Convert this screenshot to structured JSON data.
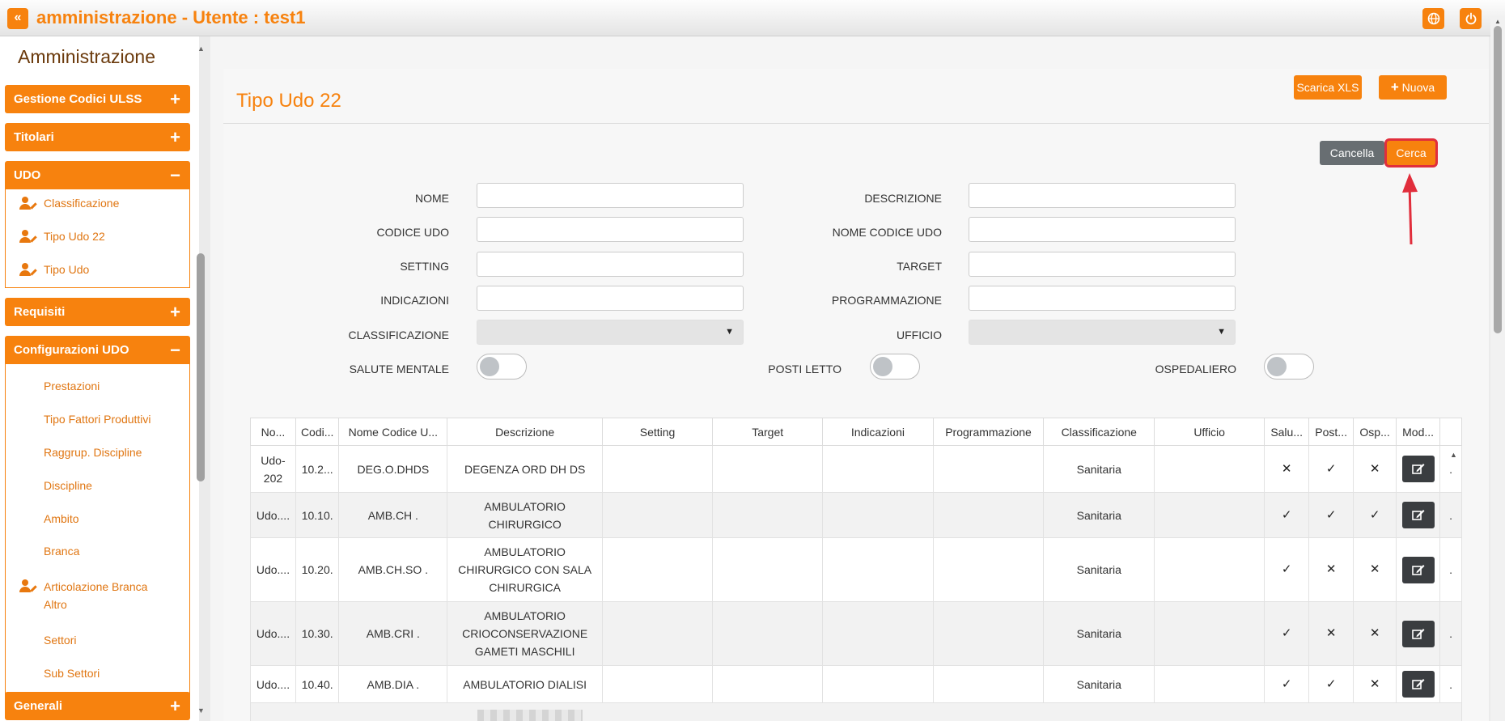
{
  "header": {
    "collapse_glyph": "«",
    "title": "amministrazione - Utente : test1",
    "icons": [
      "globe-icon",
      "power-icon"
    ]
  },
  "sidebar": {
    "title": "Amministrazione",
    "groups": [
      {
        "label": "Gestione Codici ULSS",
        "toggle": "+",
        "items": []
      },
      {
        "label": "Titolari",
        "toggle": "+",
        "items": []
      },
      {
        "label": "UDO",
        "toggle": "−",
        "items": [
          "Classificazione",
          "Tipo Udo 22",
          "Tipo Udo"
        ]
      },
      {
        "label": "Requisiti",
        "toggle": "+",
        "items": []
      },
      {
        "label": "Configurazioni UDO",
        "toggle": "−",
        "items": [
          "Prestazioni",
          "Tipo Fattori Produttivi",
          "Raggrup. Discipline",
          "Discipline",
          "Ambito",
          "Branca",
          "Articolazione Branca Altro",
          "Settori",
          "Sub Settori"
        ]
      },
      {
        "label": "Generali",
        "toggle": "+",
        "items": []
      }
    ]
  },
  "main": {
    "page_title": "Tipo Udo 22",
    "buttons": {
      "xls": "Scarica XLS",
      "new": "Nuova",
      "new_glyph": "+",
      "cancel": "Cancella",
      "search": "Cerca"
    },
    "filters": {
      "nome": "NOME",
      "descrizione": "DESCRIZIONE",
      "codice_udo": "CODICE UDO",
      "nome_codice_udo": "NOME CODICE UDO",
      "setting": "SETTING",
      "target": "TARGET",
      "indicazioni": "INDICAZIONI",
      "programmazione": "PROGRAMMAZIONE",
      "classificazione": "CLASSIFICAZIONE",
      "ufficio": "UFFICIO",
      "salute_mentale": "SALUTE MENTALE",
      "posti_letto": "POSTI LETTO",
      "ospedaliero": "OSPEDALIERO"
    },
    "table": {
      "columns": [
        "No...",
        "Codi...",
        "Nome Codice U...",
        "Descrizione",
        "Setting",
        "Target",
        "Indicazioni",
        "Programmazione",
        "Classificazione",
        "Ufficio",
        "Salu...",
        "Post...",
        "Osp...",
        "Mod..."
      ],
      "rows": [
        {
          "nome": "Udo-202",
          "codice": "10.2...",
          "nome_codice": "DEG.O.DHDS",
          "descrizione": "DEGENZA ORD DH DS",
          "classificazione": "Sanitaria",
          "salute": "✕",
          "posti": "✓",
          "osp": "✕"
        },
        {
          "nome": "Udo....",
          "codice": "10.10.",
          "nome_codice": "AMB.CH .",
          "descrizione": "AMBULATORIO CHIRURGICO",
          "classificazione": "Sanitaria",
          "salute": "✓",
          "posti": "✓",
          "osp": "✓"
        },
        {
          "nome": "Udo....",
          "codice": "10.20.",
          "nome_codice": "AMB.CH.SO .",
          "descrizione": "AMBULATORIO CHIRURGICO CON SALA CHIRURGICA",
          "classificazione": "Sanitaria",
          "salute": "✓",
          "posti": "✕",
          "osp": "✕"
        },
        {
          "nome": "Udo....",
          "codice": "10.30.",
          "nome_codice": "AMB.CRI .",
          "descrizione": "AMBULATORIO CRIOCONSERVAZIONE GAMETI MASCHILI",
          "classificazione": "Sanitaria",
          "salute": "✓",
          "posti": "✕",
          "osp": "✕"
        },
        {
          "nome": "Udo....",
          "codice": "10.40.",
          "nome_codice": "AMB.DIA .",
          "descrizione": "AMBULATORIO DIALISI",
          "classificazione": "Sanitaria",
          "salute": "✓",
          "posti": "✓",
          "osp": "✕"
        }
      ]
    }
  },
  "colors": {
    "accent": "#f7820e",
    "dark_button": "#3a3d40",
    "cancel_button": "#686e72",
    "highlight": "#e12e3c"
  }
}
